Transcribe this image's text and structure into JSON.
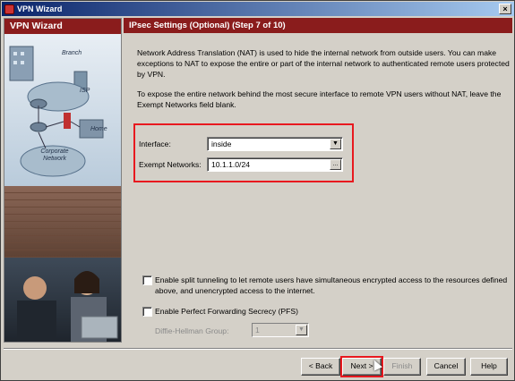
{
  "window": {
    "title": "VPN Wizard",
    "close_glyph": "×"
  },
  "sidebar": {
    "header": "VPN Wizard",
    "labels": {
      "branch": "Branch",
      "isp": "ISP",
      "home": "Home",
      "corporate": "Corporate Network"
    }
  },
  "main": {
    "header": "IPsec Settings (Optional)  (Step 7 of 10)",
    "description1": "Network Address Translation (NAT) is used to hide the internal network from outside users. You can make exceptions to NAT to expose the entire or part of the internal network to authenticated remote users protected by VPN.",
    "description2": "To expose the entire network behind the most secure interface to remote VPN users without NAT, leave the Exempt Networks field blank.",
    "interface_label": "Interface:",
    "interface_value": "inside",
    "exempt_label": "Exempt Networks:",
    "exempt_value": "10.1.1.0/24",
    "browse_glyph": "...",
    "split_tunnel_label": "Enable split tunneling to let remote users have simultaneous encrypted access to the resources defined above, and unencrypted access to the internet.",
    "split_tunnel_checked": false,
    "pfs_label": "Enable Perfect Forwarding Secrecy (PFS)",
    "pfs_checked": false,
    "dh_label": "Diffie-Hellman Group:",
    "dh_value": "1"
  },
  "buttons": {
    "back": "< Back",
    "next": "Next >",
    "finish": "Finish",
    "cancel": "Cancel",
    "help": "Help"
  },
  "icons": [
    "vpn-wizard-app-icon",
    "close-icon",
    "dropdown-arrow-icon",
    "mouse-cursor-icon"
  ],
  "colors": {
    "header_red": "#8a1c1c",
    "highlight_red": "#e8191f",
    "titlebar": "#0a246a"
  }
}
